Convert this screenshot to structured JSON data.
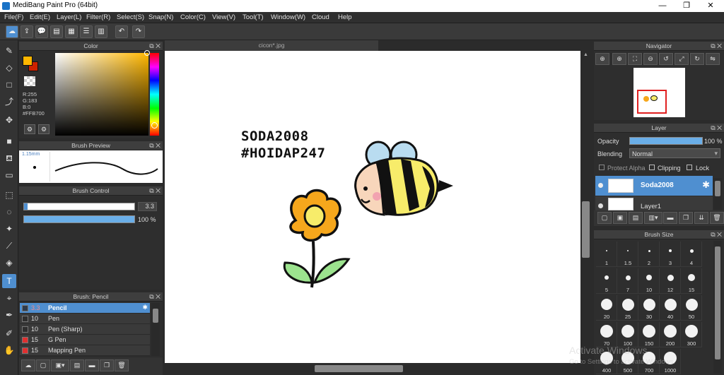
{
  "window": {
    "title": "MediBang Paint Pro (64bit)",
    "controls": [
      "—",
      "❐",
      "✕"
    ]
  },
  "menu": [
    "File(F)",
    "Edit(E)",
    "Layer(L)",
    "Filter(R)",
    "Select(S)",
    "Snap(N)",
    "Color(C)",
    "View(V)",
    "Tool(T)",
    "Window(W)",
    "Cloud",
    "Help"
  ],
  "color_panel": {
    "title": "Color",
    "r": "R:255",
    "g": "G:183",
    "b": "B:0",
    "hex": "#FFB700",
    "fg_color": "#ffb700",
    "bg_color": "#cc2200"
  },
  "brush_preview": {
    "title": "Brush Preview",
    "size": "1.15mm"
  },
  "brush_control": {
    "title": "Brush Control",
    "size_value": "3.3",
    "opacity_value": "100 %",
    "opacity_fraction": 1.0
  },
  "brush_list": {
    "title": "Brush: Pencil",
    "items": [
      {
        "size": "3.3",
        "name": "Pencil",
        "selected": true,
        "swatch": "#2f3a4a"
      },
      {
        "size": "10",
        "name": "Pen",
        "selected": false,
        "swatch": "#2e2e2e"
      },
      {
        "size": "10",
        "name": "Pen (Sharp)",
        "selected": false,
        "swatch": "#2e2e2e"
      },
      {
        "size": "15",
        "name": "G Pen",
        "selected": false,
        "swatch": "#e03030"
      },
      {
        "size": "15",
        "name": "Mapping Pen",
        "selected": false,
        "swatch": "#e03030"
      }
    ]
  },
  "canvas": {
    "tab_label": "cicon*.jpg",
    "text_line1": "SODA2008",
    "text_line2": "#HOIDAP247"
  },
  "navigator": {
    "title": "Navigator"
  },
  "layer_panel": {
    "title": "Layer",
    "opacity_label": "Opacity",
    "opacity_value": "100 %",
    "opacity_fraction": 1.0,
    "blending_label": "Blending",
    "blending_value": "Normal",
    "protect_alpha": "Protect Alpha",
    "clipping": "Clipping",
    "lock": "Lock",
    "layers": [
      {
        "name": "Soda2008",
        "selected": true
      },
      {
        "name": "Layer1",
        "selected": false
      }
    ]
  },
  "brush_size": {
    "title": "Brush Size",
    "sizes": [
      "1",
      "1.5",
      "2",
      "3",
      "4",
      "5",
      "7",
      "10",
      "12",
      "15",
      "20",
      "25",
      "30",
      "40",
      "50",
      "70",
      "100",
      "150",
      "200",
      "300",
      "400",
      "500",
      "700",
      "1000"
    ]
  },
  "watermark": {
    "line1": "Activate Windows",
    "line2": "Go to Settings to activate Windows."
  }
}
